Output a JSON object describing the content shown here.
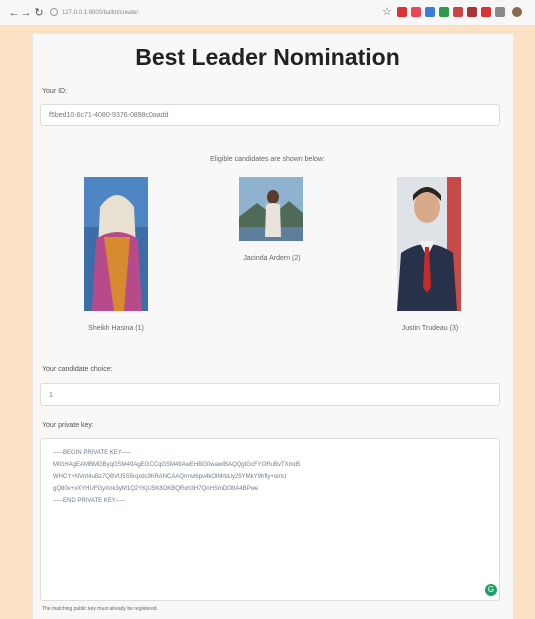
{
  "browser": {
    "url": "127.0.0.1:8000/ballot/create/",
    "icons": [
      "back-icon",
      "forward-icon",
      "reload-icon",
      "info-icon",
      "star-icon",
      "extension-icons",
      "profile-icon"
    ]
  },
  "page": {
    "title": "Best Leader Nomination",
    "your_id_label": "Your ID:",
    "your_id_value": "f5bed10-6c71-4080-9376-0898c0aadd",
    "eligible_text": "Eligible candidates are shown below:",
    "candidates": [
      {
        "name": "Sheikh Hasina (1)"
      },
      {
        "name": "Jacinda Ardern (2)"
      },
      {
        "name": "Justin Trudeau (3)"
      }
    ],
    "choice_label": "Your candidate choice:",
    "choice_value": "1",
    "key_label": "Your private key:",
    "key_lines": [
      "-----BEGIN PRIVATE KEY-----",
      "MIGHAgEAMBMGByqGSM49AgEGCCqGSM49AwEHBG0wawIBAQQgIGcFYORuBvTXmd5",
      "WHCY+NVrrl4uBz7QBVU5S5rqxdc9hRANCAAQrmvl6pv4kOlMrbUy25YMkY9hfly+omU",
      "gQ80v+xXYHUFGyXnk3yM1Q2YKjU5K8OKBQRxh3H7QnHSmD0l0A4BPwe",
      "-----END PRIVATE KEY-----"
    ],
    "footer_text": "The matching public key must already be registered."
  }
}
